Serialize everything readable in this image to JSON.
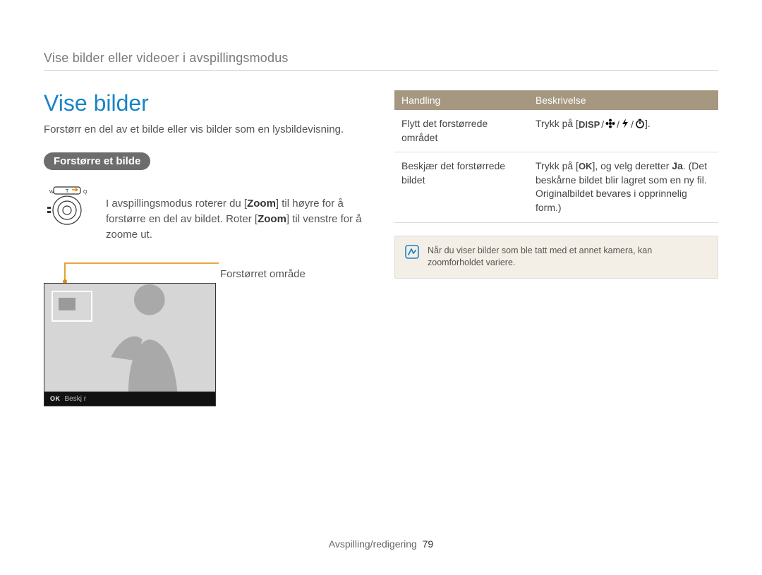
{
  "breadcrumb": "Vise bilder eller videoer i avspillingsmodus",
  "title": "Vise bilder",
  "intro": "Forstørr en del av et bilde eller vis bilder som en lysbildevisning.",
  "subsection_pill": "Forstørre et bilde",
  "zoom_instruction": {
    "pre1": "I avspillingsmodus roterer du [",
    "key1": "Zoom",
    "mid1": "] til høyre for å forstørre en del av bildet. Roter [",
    "key2": "Zoom",
    "post": "] til venstre for å zoome ut."
  },
  "zoom_dial": {
    "left_label": "W",
    "center_label": "T",
    "right_label": "Q"
  },
  "callout_label": "Forstørret område",
  "preview_bar": {
    "ok": "OK",
    "label": "Beskj r"
  },
  "table": {
    "headers": {
      "action": "Handling",
      "description": "Beskrivelse"
    },
    "rows": [
      {
        "action": "Flytt det forstørrede området",
        "desc_pre": "Trykk på [",
        "icons": [
          "DISP",
          "flower",
          "flash",
          "timer"
        ],
        "desc_post": "]."
      },
      {
        "action": "Beskjær det forstørrede bildet",
        "desc_pre": "Trykk på [",
        "ok_icon": "OK",
        "desc_mid": "], og velg deretter ",
        "bold": "Ja",
        "desc_after": ". (Det beskårne bildet blir lagret som en ny fil. Originalbildet bevares i opprinnelig form.)"
      }
    ]
  },
  "note": "Når du viser bilder som ble tatt med et annet kamera, kan zoomforholdet variere.",
  "footer": {
    "section": "Avspilling/redigering",
    "page": "79"
  }
}
